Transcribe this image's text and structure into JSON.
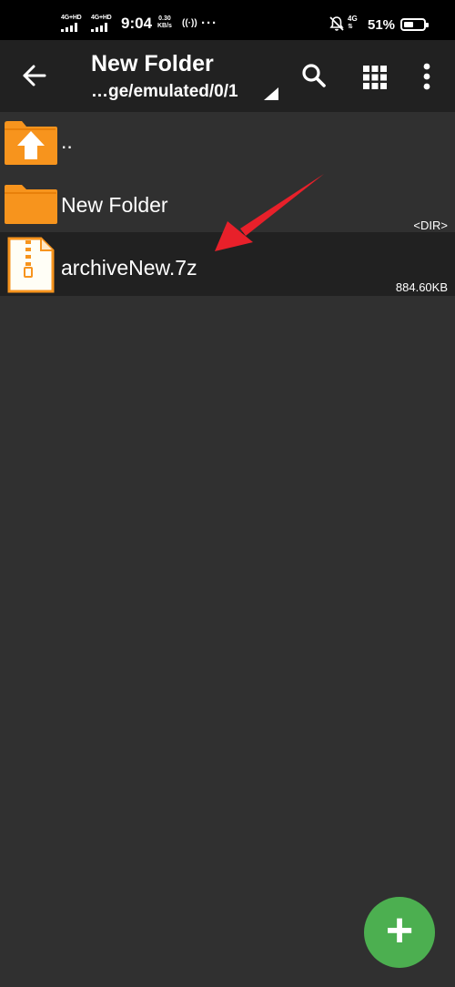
{
  "status_bar": {
    "signal_1_label": "4G+HD",
    "signal_2_label": "4G+HD",
    "time": "9:04",
    "net_speed_value": "0.30",
    "net_speed_unit": "KB/s",
    "more_indicator": "···",
    "network_type": "4G",
    "battery_percent": "51%",
    "battery_level": 0.51
  },
  "toolbar": {
    "title": "New Folder",
    "path": "…ge/emulated/0/1"
  },
  "files": [
    {
      "name": "..",
      "type": "parent-dir",
      "meta": ""
    },
    {
      "name": "New Folder",
      "type": "folder",
      "meta": "<DIR>"
    },
    {
      "name": "archiveNew.7z",
      "type": "archive",
      "meta": "884.60KB"
    }
  ],
  "fab": {
    "label": "+"
  },
  "colors": {
    "background": "#303030",
    "toolbar": "#212121",
    "folder": "#f7941d",
    "fab": "#4caf50",
    "annotation_arrow": "#e8202a"
  }
}
